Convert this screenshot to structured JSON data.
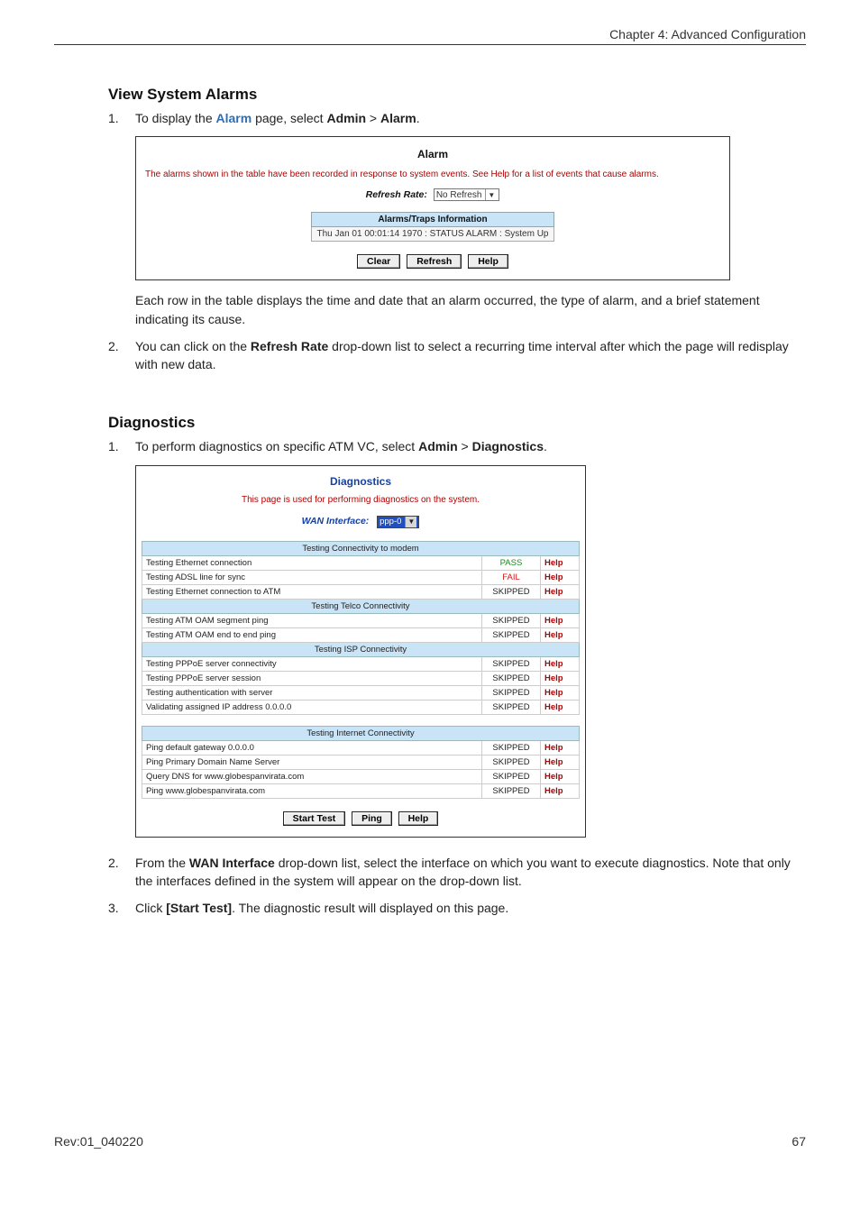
{
  "header": {
    "chapter": "Chapter 4: Advanced Configuration"
  },
  "alarms_section": {
    "heading": "View System Alarms",
    "step1_a": "To display the ",
    "step1_link": "Alarm",
    "step1_b": " page, select ",
    "step1_path_a": "Admin",
    "step1_gt": " > ",
    "step1_path_b": "Alarm",
    "step1_end": ".",
    "ui": {
      "title": "Alarm",
      "desc": "The alarms shown in the table have been recorded in response to system events. See Help for a list of events that cause alarms.",
      "refresh_label": "Refresh Rate:",
      "refresh_value": "No Refresh",
      "table_header": "Alarms/Traps Information",
      "row0": "Thu Jan 01 00:01:14 1970 : STATUS ALARM : System Up",
      "btn_clear": "Clear",
      "btn_refresh": "Refresh",
      "btn_help": "Help"
    },
    "para_after": "Each row in the table displays the time and date that an alarm occurred, the type of alarm, and a brief statement indicating its cause.",
    "step2_a": "You can click on the ",
    "step2_bold": "Refresh Rate",
    "step2_b": " drop-down list to select a recurring time interval after which the page will redisplay with new data."
  },
  "diag_section": {
    "heading": "Diagnostics",
    "step1_a": "To perform diagnostics on specific ATM VC, select ",
    "step1_path_a": "Admin",
    "step1_gt": " > ",
    "step1_path_b": "Diagnostics",
    "step1_end": ".",
    "ui": {
      "title": "Diagnostics",
      "desc": "This page is used for performing diagnostics on the system.",
      "wan_label": "WAN Interface:",
      "wan_value": "ppp-0",
      "sec_modem": "Testing Connectivity to modem",
      "sec_telco": "Testing Telco Connectivity",
      "sec_isp": "Testing ISP Connectivity",
      "sec_inet": "Testing Internet Connectivity",
      "help": "Help",
      "pass": "PASS",
      "fail": "FAIL",
      "skipped": "SKIPPED",
      "rows_modem": [
        {
          "t": "Testing Ethernet connection",
          "s": "PASS"
        },
        {
          "t": "Testing ADSL line for sync",
          "s": "FAIL"
        },
        {
          "t": "Testing Ethernet connection to ATM",
          "s": "SKIPPED"
        }
      ],
      "rows_telco": [
        {
          "t": "Testing ATM OAM segment ping",
          "s": "SKIPPED"
        },
        {
          "t": "Testing ATM OAM end to end ping",
          "s": "SKIPPED"
        }
      ],
      "rows_isp": [
        {
          "t": "Testing PPPoE server connectivity",
          "s": "SKIPPED"
        },
        {
          "t": "Testing PPPoE server session",
          "s": "SKIPPED"
        },
        {
          "t": "Testing authentication with server",
          "s": "SKIPPED"
        },
        {
          "t": "Validating assigned IP address 0.0.0.0",
          "s": "SKIPPED"
        }
      ],
      "rows_inet": [
        {
          "t": "Ping default gateway 0.0.0.0",
          "s": "SKIPPED"
        },
        {
          "t": "Ping Primary Domain Name Server",
          "s": "SKIPPED"
        },
        {
          "t": "Query DNS for www.globespanvirata.com",
          "s": "SKIPPED"
        },
        {
          "t": "Ping www.globespanvirata.com",
          "s": "SKIPPED"
        }
      ],
      "btn_start": "Start Test",
      "btn_ping": "Ping",
      "btn_help": "Help"
    },
    "step2_a": "From the ",
    "step2_bold": "WAN Interface",
    "step2_b": " drop-down list, select the interface on which you want to execute diagnostics. Note that only the interfaces defined in the system will appear on the drop-down list.",
    "step3_a": "Click ",
    "step3_bold": "[Start Test]",
    "step3_b": ". The diagnostic result will displayed on this page."
  },
  "footer": {
    "rev": "Rev:01_040220",
    "page": "67"
  }
}
